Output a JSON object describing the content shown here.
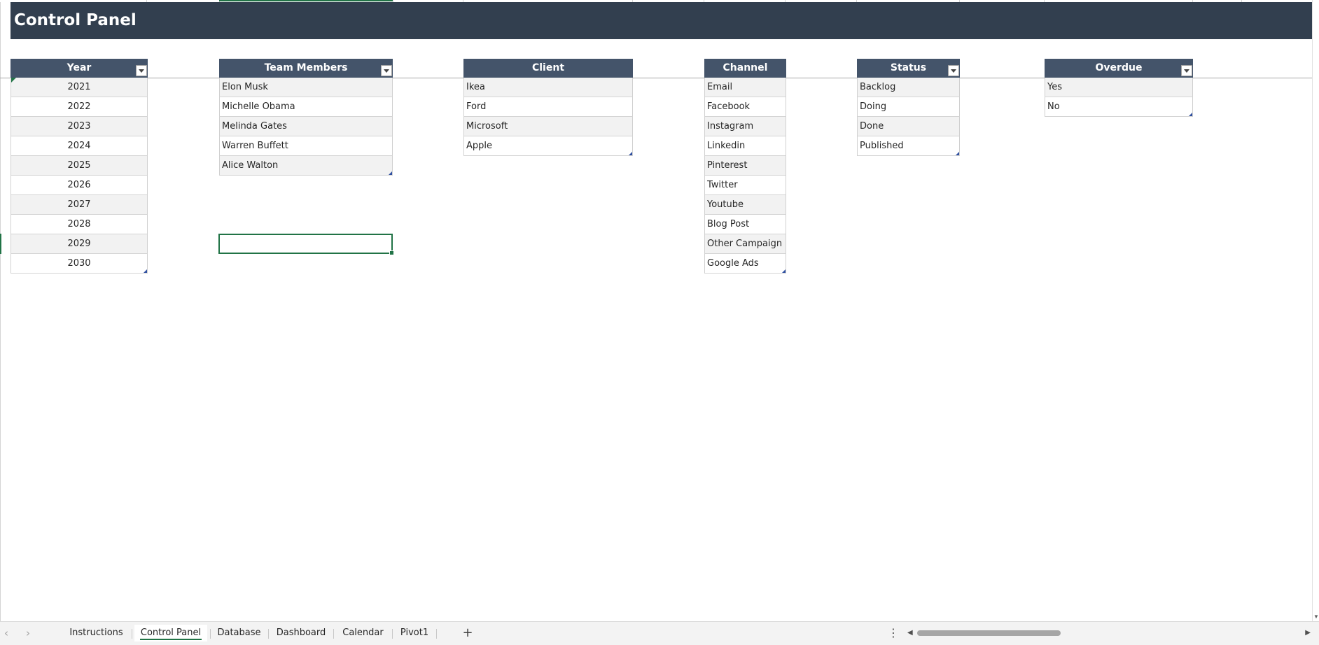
{
  "banner": {
    "title": "Control Panel"
  },
  "tables": {
    "year": {
      "header": "Year",
      "rows": [
        "2021",
        "2022",
        "2023",
        "2024",
        "2025",
        "2026",
        "2027",
        "2028",
        "2029",
        "2030"
      ]
    },
    "team": {
      "header": "Team Members",
      "rows": [
        "Elon Musk",
        "Michelle Obama",
        "Melinda Gates",
        "Warren Buffett",
        "Alice Walton"
      ]
    },
    "client": {
      "header": "Client",
      "rows": [
        "Ikea",
        "Ford",
        "Microsoft",
        "Apple"
      ]
    },
    "channel": {
      "header": "Channel",
      "rows": [
        "Email",
        "Facebook",
        "Instagram",
        "Linkedin",
        "Pinterest",
        "Twitter",
        "Youtube",
        "Blog Post",
        "Other Campaign",
        "Google Ads"
      ]
    },
    "status": {
      "header": "Status",
      "rows": [
        "Backlog",
        "Doing",
        "Done",
        "Published"
      ]
    },
    "overdue": {
      "header": "Overdue",
      "rows": [
        "Yes",
        "No"
      ]
    }
  },
  "sheet_tabs": {
    "items": [
      "Instructions",
      "Control Panel",
      "Database",
      "Dashboard",
      "Calendar",
      "Pivot1"
    ],
    "active": "Control Panel",
    "add_label": "+",
    "more_label": "⋮"
  },
  "colors": {
    "banner_bg": "#323f4f",
    "header_bg": "#44546a",
    "accent": "#217346",
    "band": "#f2f2f2"
  }
}
